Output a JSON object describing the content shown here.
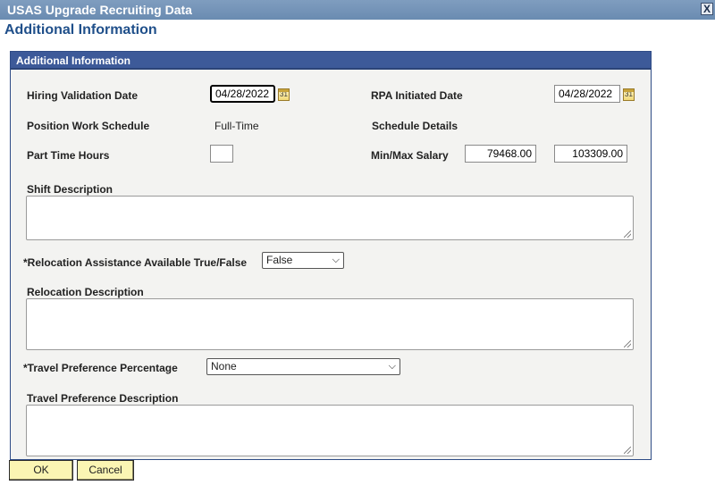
{
  "window": {
    "title": "USAS Upgrade Recruiting Data",
    "close_label": "X"
  },
  "page": {
    "title": "Additional Information"
  },
  "panel": {
    "header": "Additional Information"
  },
  "form": {
    "hiring_validation_date": {
      "label": "Hiring Validation Date",
      "value": "04/28/2022"
    },
    "rpa_initiated_date": {
      "label": "RPA Initiated Date",
      "value": "04/28/2022"
    },
    "position_work_schedule": {
      "label": "Position Work Schedule",
      "value": "Full-Time"
    },
    "schedule_details": {
      "label": "Schedule Details"
    },
    "part_time_hours": {
      "label": "Part Time Hours",
      "value": ""
    },
    "min_max_salary": {
      "label": "Min/Max Salary",
      "min": "79468.00",
      "max": "103309.00"
    },
    "shift_description": {
      "label": "Shift Description",
      "value": ""
    },
    "relocation_assistance": {
      "label": "*Relocation Assistance Available True/False",
      "selected": "False"
    },
    "relocation_description": {
      "label": "Relocation Description",
      "value": ""
    },
    "travel_preference_percentage": {
      "label": "*Travel Preference Percentage",
      "selected": "None"
    },
    "travel_preference_description": {
      "label": "Travel Preference Description",
      "value": ""
    }
  },
  "buttons": {
    "ok": "OK",
    "cancel": "Cancel"
  },
  "icons": {
    "calendar": "calendar-icon",
    "dropdown": "chevron-down-icon",
    "close": "close-icon"
  }
}
